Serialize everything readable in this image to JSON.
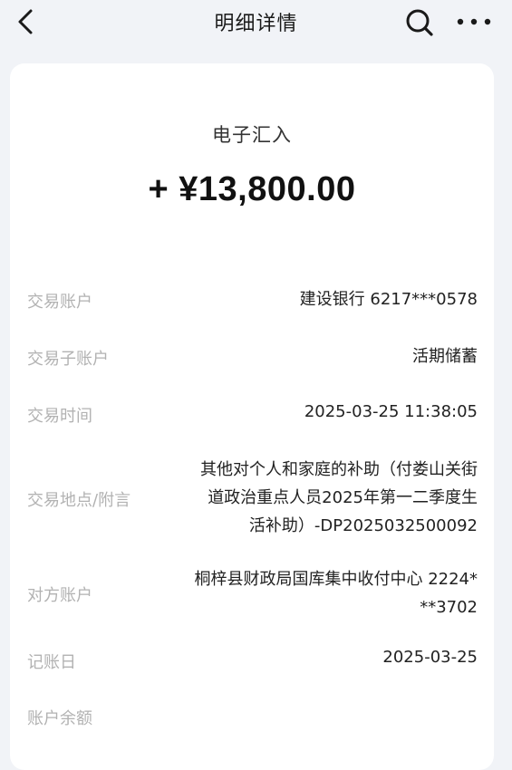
{
  "header": {
    "title": "明细详情",
    "back_icon": "chevron-left-icon",
    "search_icon": "search-icon",
    "more_icon": "more-horizontal-icon"
  },
  "transaction": {
    "type": "电子汇入",
    "amount": "+ ¥13,800.00"
  },
  "details": {
    "account": {
      "label": "交易账户",
      "value": "建设银行 6217***0578"
    },
    "sub_account": {
      "label": "交易子账户",
      "value": "活期储蓄"
    },
    "time": {
      "label": "交易时间",
      "value": "2025-03-25 11:38:05"
    },
    "note": {
      "label": "交易地点/附言",
      "lines": [
        "其他对个人和家庭的补助（付娄山关街",
        "道政治重点人员2025年第一二季度生",
        "活补助）-DP2025032500092"
      ]
    },
    "counterparty": {
      "label": "对方账户",
      "lines": [
        "桐梓县财政局国库集中收付中心 2224*",
        "**3702"
      ]
    },
    "posting_date": {
      "label": "记账日",
      "value": "2025-03-25"
    },
    "balance": {
      "label": "账户余额",
      "value": ""
    }
  }
}
